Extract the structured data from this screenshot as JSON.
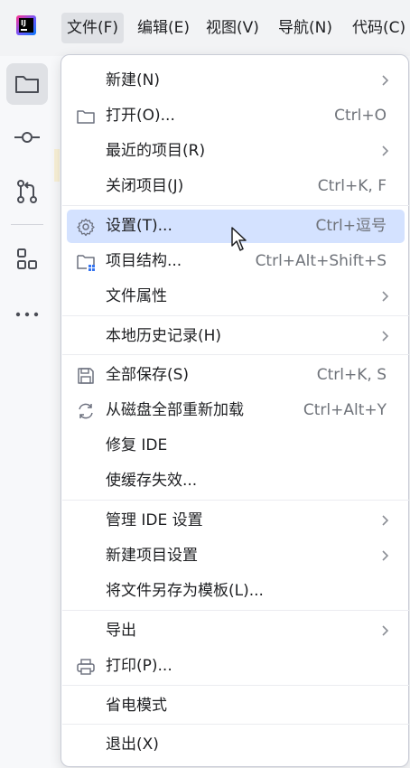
{
  "menubar": {
    "logo_text": "IJ",
    "items": [
      "文件(F)",
      "编辑(E)",
      "视图(V)",
      "导航(N)",
      "代码(C)"
    ]
  },
  "toolstrip": {
    "items": [
      "project-folder-icon",
      "commit-icon",
      "pull-requests-icon",
      "structure-icon",
      "more-icon"
    ]
  },
  "menu": {
    "new": {
      "label": "新建(N)"
    },
    "open": {
      "label": "打开(O)...",
      "shortcut": "Ctrl+O"
    },
    "recent": {
      "label": "最近的项目(R)"
    },
    "close_project": {
      "label": "关闭项目(J)",
      "shortcut": "Ctrl+K, F"
    },
    "settings": {
      "label": "设置(T)...",
      "shortcut": "Ctrl+逗号"
    },
    "project_structure": {
      "label": "项目结构...",
      "shortcut": "Ctrl+Alt+Shift+S"
    },
    "file_properties": {
      "label": "文件属性"
    },
    "local_history": {
      "label": "本地历史记录(H)"
    },
    "save_all": {
      "label": "全部保存(S)",
      "shortcut": "Ctrl+K, S"
    },
    "reload": {
      "label": "从磁盘全部重新加载",
      "shortcut": "Ctrl+Alt+Y"
    },
    "repair_ide": {
      "label": "修复 IDE"
    },
    "invalidate_caches": {
      "label": "使缓存失效..."
    },
    "manage_ide_settings": {
      "label": "管理 IDE 设置"
    },
    "new_project_settings": {
      "label": "新建项目设置"
    },
    "save_as_template": {
      "label": "将文件另存为模板(L)..."
    },
    "export": {
      "label": "导出"
    },
    "print": {
      "label": "打印(P)..."
    },
    "power_save": {
      "label": "省电模式"
    },
    "exit": {
      "label": "退出(X)"
    }
  },
  "colors": {
    "hover_bg": "#d4e2ff",
    "shortcut_text": "#6f737a",
    "menu_bg": "#ffffff"
  }
}
